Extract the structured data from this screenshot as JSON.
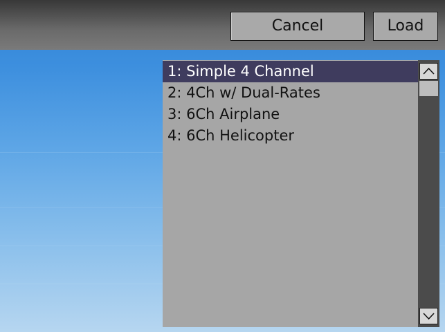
{
  "toolbar": {
    "cancel_label": "Cancel",
    "load_label": "Load"
  },
  "template_list": {
    "items": [
      {
        "label": "1: Simple 4 Channel",
        "selected": true
      },
      {
        "label": "2: 4Ch w/ Dual-Rates",
        "selected": false
      },
      {
        "label": "3: 6Ch Airplane",
        "selected": false
      },
      {
        "label": "4: 6Ch Helicopter",
        "selected": false
      }
    ]
  },
  "scrollbar": {
    "up_icon": "chevron-up-icon",
    "down_icon": "chevron-down-icon"
  },
  "colors": {
    "selection": "#3f3c5e",
    "list_background": "#a6a6a6",
    "scrollbar_track": "#4b4b4b"
  }
}
